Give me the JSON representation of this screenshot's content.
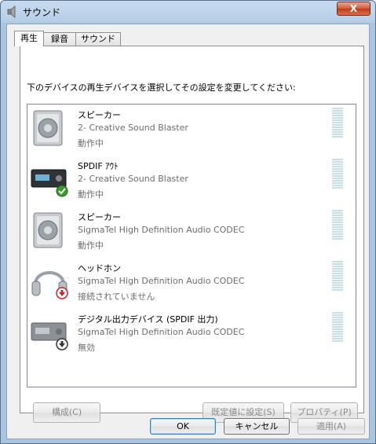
{
  "window": {
    "title": "サウンド",
    "close_glyph": "X"
  },
  "tabs": [
    {
      "label": "再生",
      "active": true
    },
    {
      "label": "録音",
      "active": false
    },
    {
      "label": "サウンド",
      "active": false
    }
  ],
  "instruction": "下のデバイスの再生デバイスを選択してその設定を変更してください:",
  "devices": [
    {
      "name": "スピーカー",
      "description": "2- Creative Sound Blaster",
      "status": "動作中",
      "icon": "speaker-icon",
      "badge": ""
    },
    {
      "name": "SPDIF ｱｳﾄ",
      "description": "2- Creative Sound Blaster",
      "status": "動作中",
      "icon": "spdif-device-icon",
      "badge": "default-check-badge"
    },
    {
      "name": "スピーカー",
      "description": "SigmaTel High Definition Audio CODEC",
      "status": "動作中",
      "icon": "speaker-icon",
      "badge": ""
    },
    {
      "name": "ヘッドホン",
      "description": "SigmaTel High Definition Audio CODEC",
      "status": "接続されていません",
      "icon": "headphones-icon",
      "badge": "unplugged-red-badge"
    },
    {
      "name": "デジタル出力デバイス (SPDIF 出力)",
      "description": "SigmaTel High Definition Audio CODEC",
      "status": "無効",
      "icon": "digital-output-icon",
      "badge": "disabled-black-badge"
    }
  ],
  "panel_buttons": {
    "configure": "構成(C)",
    "set_default": "既定値に設定(S)",
    "properties": "プロパティ(P)"
  },
  "dialog_buttons": {
    "ok": "OK",
    "cancel": "キャンセル",
    "apply": "適用(A)"
  },
  "colors": {
    "accent_check": "#3a9b2a",
    "unplugged": "#c62828",
    "meter": "#c7dfe6"
  }
}
